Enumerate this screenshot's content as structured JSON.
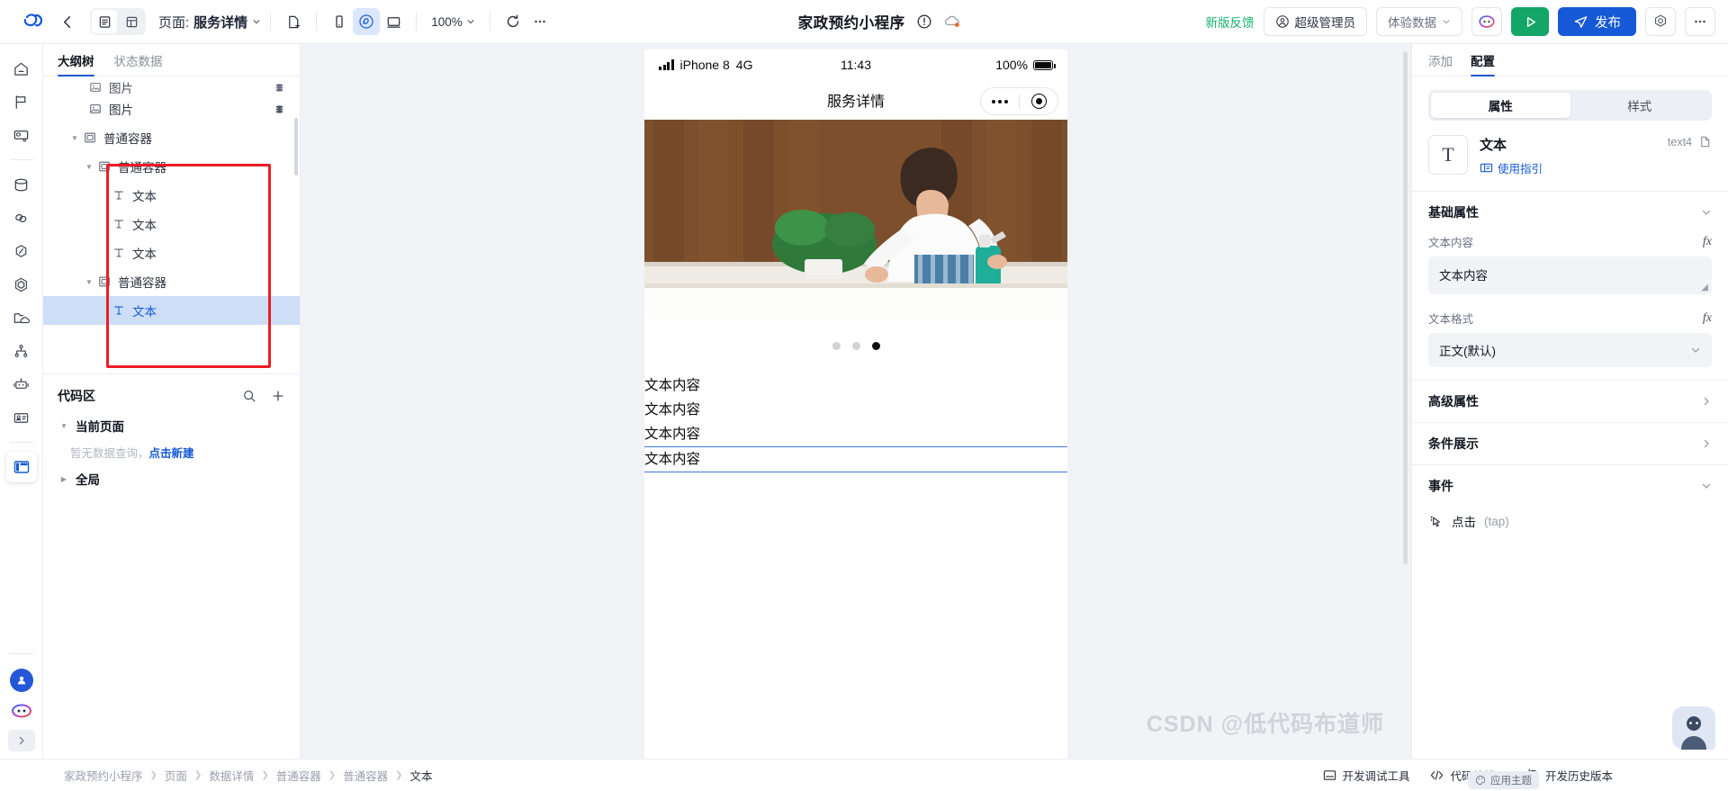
{
  "topbar": {
    "logo_icon": "lowcode-logo-icon",
    "back_icon": "back-arrow-icon",
    "view_doc_icon": "document-view-icon",
    "view_grid_icon": "grid-view-icon",
    "page_label": "页面:",
    "page_name": "服务详情",
    "new_page_icon": "new-page-icon",
    "device_mobile_icon": "mobile-device-icon",
    "device_mini_icon": "miniprogram-device-icon",
    "device_desktop_icon": "desktop-device-icon",
    "zoom_value": "100%",
    "refresh_icon": "refresh-icon",
    "more_icon": "more-horizontal-icon",
    "app_title": "家政预约小程序",
    "warning_icon": "warning-circle-icon",
    "cloud_icon": "cloud-status-icon",
    "feedback_label": "新版反馈",
    "role_label": "超级管理员",
    "role_icon": "user-circle-icon",
    "env_label": "体验数据",
    "ai_icon": "ai-assistant-icon",
    "preview_icon": "play-preview-icon",
    "publish_label": "发布",
    "publish_icon": "send-icon",
    "settings_icon": "settings-hex-icon",
    "overflow_icon": "more-horizontal-icon"
  },
  "rail": {
    "items": [
      {
        "name": "home-icon"
      },
      {
        "name": "flag-icon"
      },
      {
        "name": "card-cart-icon"
      },
      {
        "name": "database-icon"
      },
      {
        "name": "link-icon"
      },
      {
        "name": "slash-hex-icon"
      },
      {
        "name": "hexagon-icon"
      },
      {
        "name": "folder-cloud-icon"
      },
      {
        "name": "sitemap-icon"
      },
      {
        "name": "robot-icon"
      },
      {
        "name": "id-card-icon"
      },
      {
        "name": "layout-panel-icon"
      }
    ],
    "avatar_icon": "user-avatar-icon",
    "assistant_icon": "ai-face-icon",
    "collapse_icon": "chevron-right-icon"
  },
  "left_panel": {
    "tabs": [
      {
        "label": "大纲树",
        "active": true
      },
      {
        "label": "状态数据",
        "active": false
      }
    ],
    "tree": [
      {
        "label": "图片",
        "icon": "image-icon",
        "depth": 2,
        "caret": "",
        "badge": "database-stack-icon",
        "selected": false,
        "partial": true
      },
      {
        "label": "图片",
        "icon": "image-icon",
        "depth": 2,
        "caret": "",
        "badge": "database-stack-icon",
        "selected": false
      },
      {
        "label": "普通容器",
        "icon": "container-icon",
        "depth": 1,
        "caret": "down",
        "badge": "",
        "selected": false
      },
      {
        "label": "普通容器",
        "icon": "container-icon",
        "depth": 2,
        "caret": "down",
        "badge": "",
        "selected": false
      },
      {
        "label": "文本",
        "icon": "text-icon",
        "depth": 3,
        "caret": "",
        "badge": "",
        "selected": false
      },
      {
        "label": "文本",
        "icon": "text-icon",
        "depth": 3,
        "caret": "",
        "badge": "",
        "selected": false
      },
      {
        "label": "文本",
        "icon": "text-icon",
        "depth": 3,
        "caret": "",
        "badge": "",
        "selected": false
      },
      {
        "label": "普通容器",
        "icon": "container-icon",
        "depth": 2,
        "caret": "down",
        "badge": "",
        "selected": false
      },
      {
        "label": "文本",
        "icon": "text-icon",
        "depth": 3,
        "caret": "",
        "badge": "",
        "selected": true
      }
    ],
    "code_section": {
      "title": "代码区",
      "search_icon": "search-icon",
      "add_icon": "plus-icon",
      "current_page_label": "当前页面",
      "empty_text": "暂无数据查询，",
      "empty_link": "点击新建",
      "global_label": "全局"
    }
  },
  "canvas": {
    "status_bar": {
      "signal_icon": "signal-bars-icon",
      "device": "iPhone 8",
      "network": "4G",
      "time": "11:43",
      "battery_percent": "100%",
      "battery_icon": "battery-full-icon"
    },
    "nav_title": "服务详情",
    "capsule": {
      "more_icon": "capsule-more-icon",
      "target_icon": "capsule-target-icon"
    },
    "carousel": {
      "dots": 3,
      "active_index": 2
    },
    "text_items": [
      "文本内容",
      "文本内容",
      "文本内容",
      "文本内容"
    ],
    "selected_text_index": 3,
    "watermark": "CSDN @低代码布道师"
  },
  "right_panel": {
    "tabs": [
      {
        "label": "添加",
        "active": false
      },
      {
        "label": "配置",
        "active": true
      }
    ],
    "segment": [
      {
        "label": "属性",
        "active": true
      },
      {
        "label": "样式",
        "active": false
      }
    ],
    "component": {
      "type_glyph": "T",
      "name": "文本",
      "guide_label": "使用指引",
      "guide_icon": "book-icon",
      "id": "text4",
      "copy_icon": "copy-icon"
    },
    "sections": [
      {
        "title": "基础属性",
        "state": "expanded",
        "chevron": "chevron-down-icon"
      },
      {
        "title": "高级属性",
        "state": "collapsed",
        "chevron": "chevron-right-icon"
      },
      {
        "title": "条件展示",
        "state": "collapsed",
        "chevron": "chevron-right-icon"
      },
      {
        "title": "事件",
        "state": "expanded",
        "chevron": "chevron-down-icon"
      }
    ],
    "fields": {
      "text_content_label": "文本内容",
      "text_content_value": "文本内容",
      "text_format_label": "文本格式",
      "text_format_value": "正文(默认)",
      "fx_icon": "fx-formula-icon",
      "resize_icon": "resize-handle-icon"
    },
    "events": [
      {
        "label": "点击",
        "sub": "(tap)",
        "icon": "click-cursor-icon"
      }
    ]
  },
  "bottom_bar": {
    "breadcrumb": [
      "家政预约小程序",
      "页面",
      "数据详情",
      "普通容器",
      "普通容器",
      "文本"
    ],
    "actions": [
      {
        "label": "开发调试工具",
        "icon": "debug-window-icon"
      },
      {
        "label": "代码编辑器",
        "icon": "code-brackets-icon"
      },
      {
        "label": "开发历史版本",
        "icon": "history-clock-icon"
      }
    ],
    "theme_chip": {
      "label": "应用主题",
      "icon": "palette-icon"
    },
    "chat_icon": "chat-assistant-icon"
  },
  "colors": {
    "accent_blue": "#1559d6",
    "green": "#16b06a",
    "select_blue": "#cfdef7",
    "red_box": "#ec1c24"
  }
}
